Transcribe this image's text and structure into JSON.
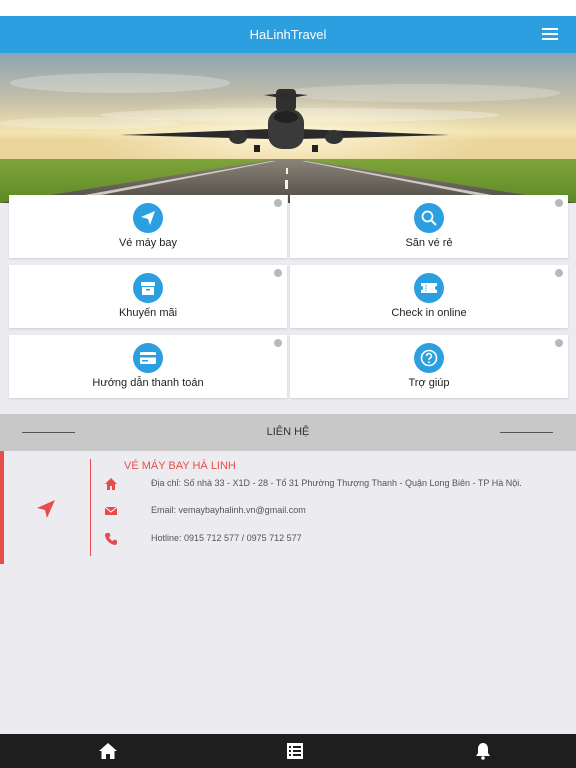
{
  "header": {
    "title": "HaLinhTravel",
    "menu_icon": "hamburger-menu-icon"
  },
  "colors": {
    "accent": "#2b9fe0",
    "contact_red": "#e84c4c",
    "tabbar": "#1e1e1e"
  },
  "hero": {
    "image": "airplane-taking-off-runway"
  },
  "tiles": [
    {
      "label": "Vé máy bay",
      "icon": "paper-plane-icon"
    },
    {
      "label": "Săn vé rẻ",
      "icon": "magnifier-icon"
    },
    {
      "label": "Khuyến mãi",
      "icon": "archive-box-icon"
    },
    {
      "label": "Check in online",
      "icon": "ticket-icon"
    },
    {
      "label": "Hướng dẫn thanh toán",
      "icon": "credit-card-icon"
    },
    {
      "label": "Trợ giúp",
      "icon": "question-mark-icon"
    }
  ],
  "contact": {
    "title": "LIÊN HỆ",
    "company": "VÉ MÁY BAY HÀ LINH",
    "address": "Địa chỉ: Số nhà 33 - X1D - 28 - Tổ 31 Phường Thượng Thanh - Quận Long Biên - TP Hà Nội.",
    "email": "Email: vemaybayhalinh.vn@gmail.com",
    "hotline": "Hotline: 0915 712 577 / 0975 712 577"
  },
  "tabbar": {
    "items": [
      "home-icon",
      "list-icon",
      "bell-icon"
    ]
  }
}
